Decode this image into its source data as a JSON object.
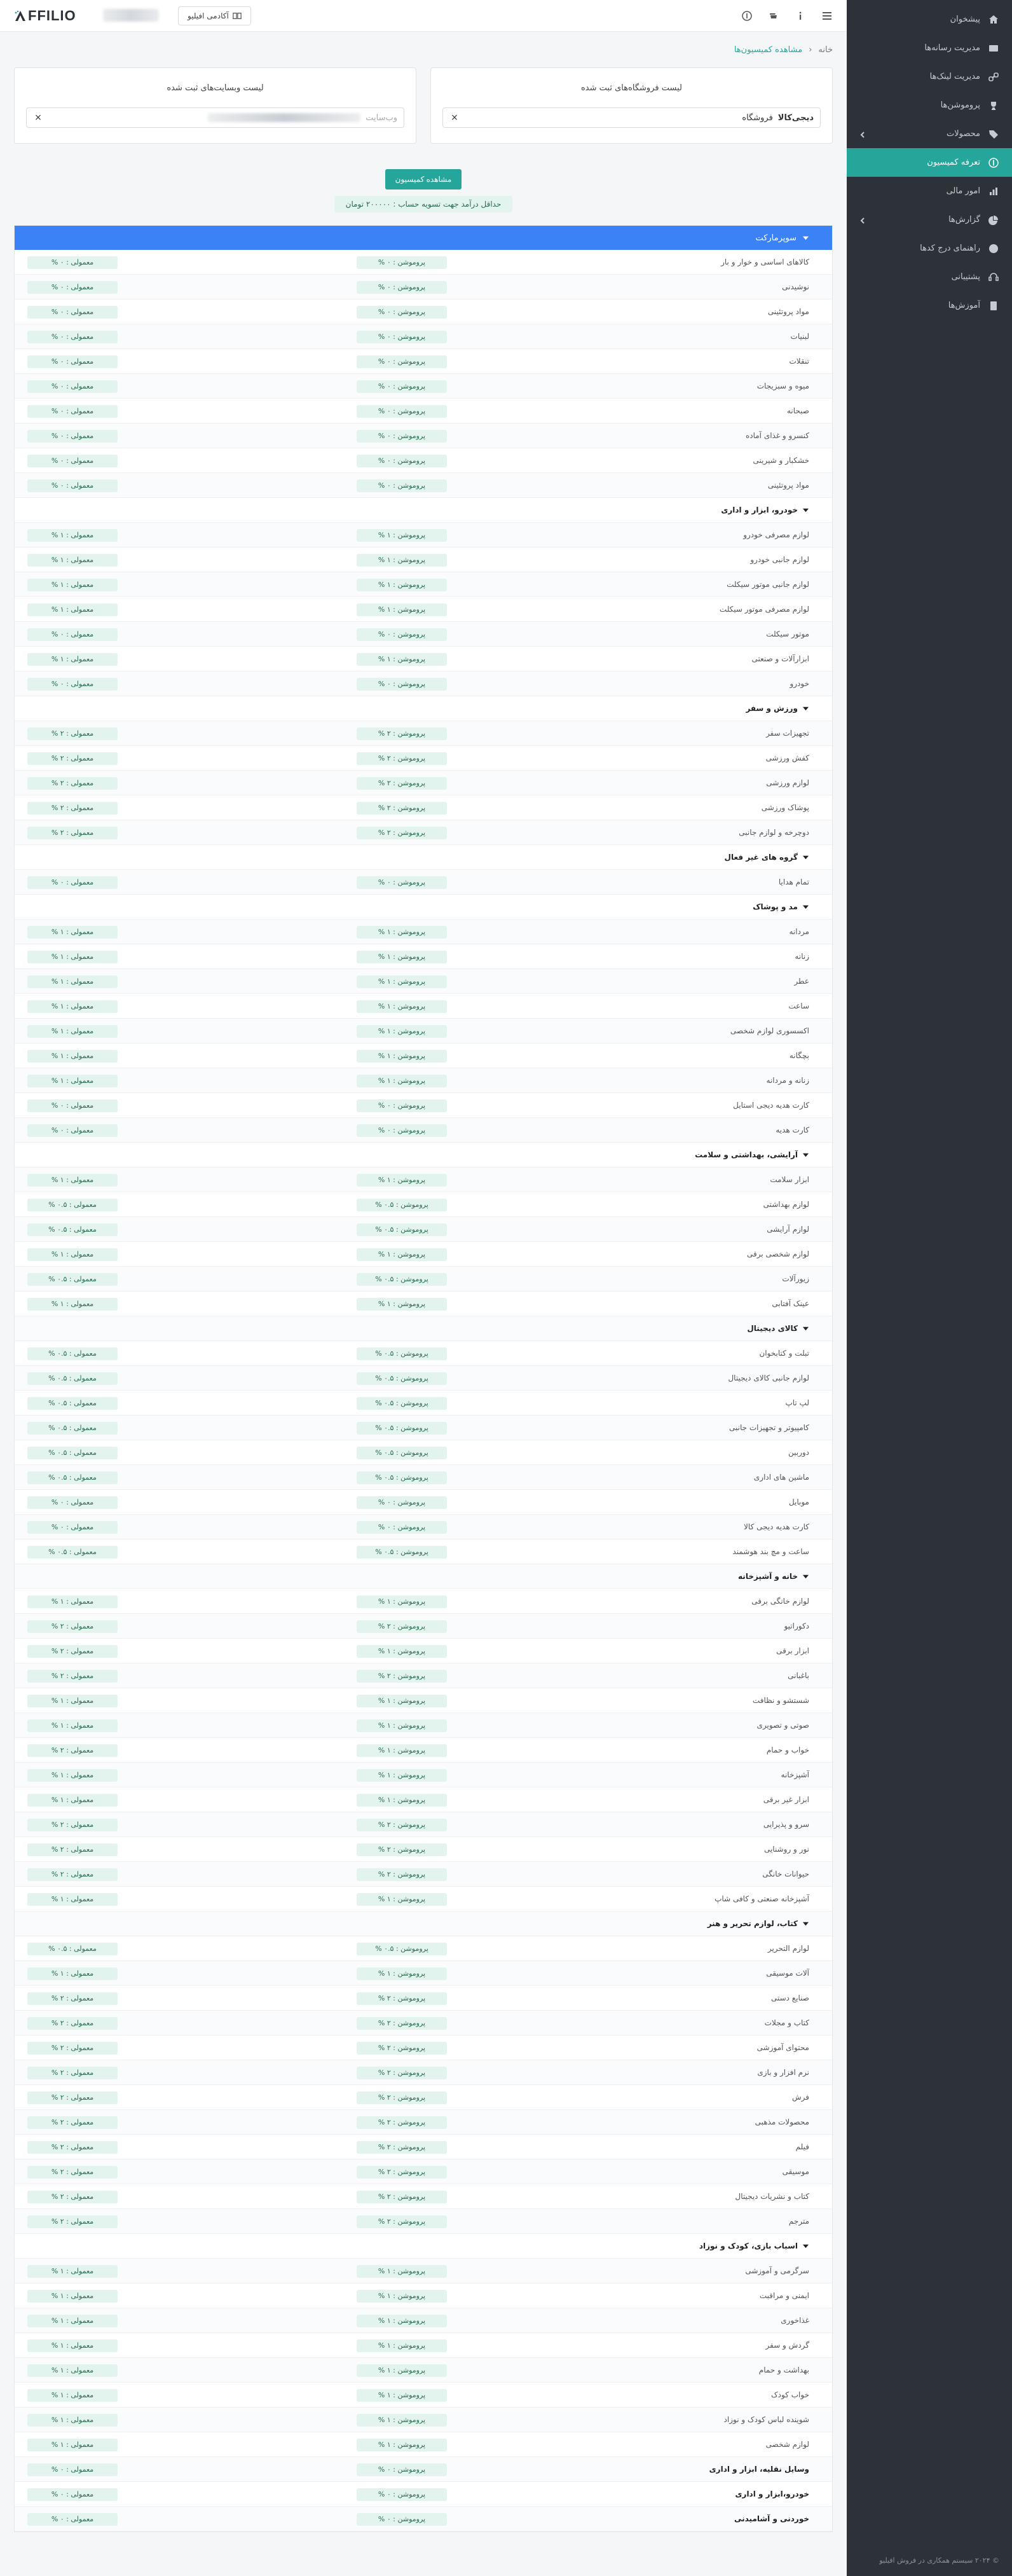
{
  "sidebar": {
    "items": [
      {
        "label": "پیشخوان",
        "icon": "home-icon",
        "active": false,
        "has_chevron": false
      },
      {
        "label": "مدیریت رسانه‌ها",
        "icon": "media-icon",
        "active": false,
        "has_chevron": false
      },
      {
        "label": "مدیریت لینک‌ها",
        "icon": "link-icon",
        "active": false,
        "has_chevron": false
      },
      {
        "label": "پروموشن‌ها",
        "icon": "trophy-icon",
        "active": false,
        "has_chevron": false
      },
      {
        "label": "محصولات",
        "icon": "tags-icon",
        "active": false,
        "has_chevron": true
      },
      {
        "label": "تعرفه کمیسیون",
        "icon": "dollar-icon",
        "active": true,
        "has_chevron": false
      },
      {
        "label": "امور مالی",
        "icon": "finance-icon",
        "active": false,
        "has_chevron": false
      },
      {
        "label": "گزارش‌ها",
        "icon": "pie-chart-icon",
        "active": false,
        "has_chevron": true
      },
      {
        "label": "راهنمای درج کدها",
        "icon": "help-icon",
        "active": false,
        "has_chevron": false
      },
      {
        "label": "پشتیبانی",
        "icon": "support-icon",
        "active": false,
        "has_chevron": false
      },
      {
        "label": "آموزش‌ها",
        "icon": "book-icon",
        "active": false,
        "has_chevron": false
      }
    ],
    "footer": "© ۲۰۲۴ سیستم همکاری در فروش افیلیو"
  },
  "topbar": {
    "academy_label": "آکادمی افیلیو",
    "logo_text": "FFILIO"
  },
  "breadcrumb": {
    "home": "خانه",
    "separator": "‹",
    "current": "مشاهده کمیسیون‌ها"
  },
  "filters": {
    "stores": {
      "title": "لیست فروشگاه‌های ثبت شده",
      "selected_name": "دیجی‌کالا",
      "selected_kind": "فروشگاه"
    },
    "websites": {
      "title": "لیست وبسایت‌های ثبت شده",
      "selected_kind": "وب‌سایت"
    }
  },
  "actions": {
    "view_button": "مشاهده کمیسیون",
    "min_settlement": "حداقل درآمد جهت تسویه حساب : ۲۰۰۰۰۰ تومان"
  },
  "table": {
    "header": "سوپرمارکت",
    "rows": [
      {
        "type": "item",
        "name": "کالاهای اساسی و خوار و بار",
        "promo": "پروموشن : ۰ %",
        "normal": "معمولی : ۰ %"
      },
      {
        "type": "item",
        "name": "نوشیدنی",
        "promo": "پروموشن : ۰ %",
        "normal": "معمولی : ۰ %"
      },
      {
        "type": "item",
        "name": "مواد پروتئینی",
        "promo": "پروموشن : ۰ %",
        "normal": "معمولی : ۰ %"
      },
      {
        "type": "item",
        "name": "لبنیات",
        "promo": "پروموشن : ۰ %",
        "normal": "معمولی : ۰ %"
      },
      {
        "type": "item",
        "name": "تنقلات",
        "promo": "پروموشن : ۰ %",
        "normal": "معمولی : ۰ %"
      },
      {
        "type": "item",
        "name": "میوه و سبزیجات",
        "promo": "پروموشن : ۰ %",
        "normal": "معمولی : ۰ %"
      },
      {
        "type": "item",
        "name": "صبحانه",
        "promo": "پروموشن : ۰ %",
        "normal": "معمولی : ۰ %"
      },
      {
        "type": "item",
        "name": "کنسرو و غذای آماده",
        "promo": "پروموشن : ۰ %",
        "normal": "معمولی : ۰ %"
      },
      {
        "type": "item",
        "name": "خشکبار و شیرینی",
        "promo": "پروموشن : ۰ %",
        "normal": "معمولی : ۰ %"
      },
      {
        "type": "item",
        "name": "مواد پروتئینی",
        "promo": "پروموشن : ۰ %",
        "normal": "معمولی : ۰ %"
      },
      {
        "type": "cat",
        "name": "خودرو، ابزار و اداری"
      },
      {
        "type": "item",
        "name": "لوازم مصرفی خودرو",
        "promo": "پروموشن : ۱ %",
        "normal": "معمولی : ۱ %"
      },
      {
        "type": "item",
        "name": "لوازم جانبی خودرو",
        "promo": "پروموشن : ۱ %",
        "normal": "معمولی : ۱ %"
      },
      {
        "type": "item",
        "name": "لوازم جانبی موتور سیکلت",
        "promo": "پروموشن : ۱ %",
        "normal": "معمولی : ۱ %"
      },
      {
        "type": "item",
        "name": "لوازم مصرفی موتور سیکلت",
        "promo": "پروموشن : ۱ %",
        "normal": "معمولی : ۱ %"
      },
      {
        "type": "item",
        "name": "موتور سیکلت",
        "promo": "پروموشن : ۰ %",
        "normal": "معمولی : ۰ %"
      },
      {
        "type": "item",
        "name": "ابزارآلات و صنعتی",
        "promo": "پروموشن : ۱ %",
        "normal": "معمولی : ۱ %"
      },
      {
        "type": "item",
        "name": "خودرو",
        "promo": "پروموشن : ۰ %",
        "normal": "معمولی : ۰ %"
      },
      {
        "type": "cat",
        "name": "ورزش و سفر"
      },
      {
        "type": "item",
        "name": "تجهیزات سفر",
        "promo": "پروموشن : ۲ %",
        "normal": "معمولی : ۲ %"
      },
      {
        "type": "item",
        "name": "کفش ورزشی",
        "promo": "پروموشن : ۲ %",
        "normal": "معمولی : ۲ %"
      },
      {
        "type": "item",
        "name": "لوازم ورزشی",
        "promo": "پروموشن : ۲ %",
        "normal": "معمولی : ۲ %"
      },
      {
        "type": "item",
        "name": "پوشاک ورزشی",
        "promo": "پروموشن : ۲ %",
        "normal": "معمولی : ۲ %"
      },
      {
        "type": "item",
        "name": "دوچرخه و لوازم جانبی",
        "promo": "پروموشن : ۲ %",
        "normal": "معمولی : ۲ %"
      },
      {
        "type": "cat",
        "name": "گروه های غیر فعال"
      },
      {
        "type": "item",
        "name": "تمام هدایا",
        "promo": "پروموشن : ۰ %",
        "normal": "معمولی : ۰ %"
      },
      {
        "type": "cat",
        "name": "مد و پوشاک"
      },
      {
        "type": "item",
        "name": "مردانه",
        "promo": "پروموشن : ۱ %",
        "normal": "معمولی : ۱ %"
      },
      {
        "type": "item",
        "name": "زنانه",
        "promo": "پروموشن : ۱ %",
        "normal": "معمولی : ۱ %"
      },
      {
        "type": "item",
        "name": "عطر",
        "promo": "پروموشن : ۱ %",
        "normal": "معمولی : ۱ %"
      },
      {
        "type": "item",
        "name": "ساعت",
        "promo": "پروموشن : ۱ %",
        "normal": "معمولی : ۱ %"
      },
      {
        "type": "item",
        "name": "اکسسوری لوازم شخصی",
        "promo": "پروموشن : ۱ %",
        "normal": "معمولی : ۱ %"
      },
      {
        "type": "item",
        "name": "بچگانه",
        "promo": "پروموشن : ۱ %",
        "normal": "معمولی : ۱ %"
      },
      {
        "type": "item",
        "name": "زنانه و مردانه",
        "promo": "پروموشن : ۱ %",
        "normal": "معمولی : ۱ %"
      },
      {
        "type": "item",
        "name": "کارت هدیه دیجی استایل",
        "promo": "پروموشن : ۰ %",
        "normal": "معمولی : ۰ %"
      },
      {
        "type": "item",
        "name": "کارت هدیه",
        "promo": "پروموشن : ۰ %",
        "normal": "معمولی : ۰ %"
      },
      {
        "type": "cat",
        "name": "آرایشی، بهداشتی و سلامت"
      },
      {
        "type": "item",
        "name": "ابزار سلامت",
        "promo": "پروموشن : ۱ %",
        "normal": "معمولی : ۱ %"
      },
      {
        "type": "item",
        "name": "لوازم بهداشتی",
        "promo": "پروموشن : ۰.۵ %",
        "normal": "معمولی : ۰.۵ %"
      },
      {
        "type": "item",
        "name": "لوازم آرایشی",
        "promo": "پروموشن : ۰.۵ %",
        "normal": "معمولی : ۰.۵ %"
      },
      {
        "type": "item",
        "name": "لوازم شخصی برقی",
        "promo": "پروموشن : ۱ %",
        "normal": "معمولی : ۱ %"
      },
      {
        "type": "item",
        "name": "زیورآلات",
        "promo": "پروموشن : ۰.۵ %",
        "normal": "معمولی : ۰.۵ %"
      },
      {
        "type": "item",
        "name": "عینک آفتابی",
        "promo": "پروموشن : ۱ %",
        "normal": "معمولی : ۱ %"
      },
      {
        "type": "cat",
        "name": "کالای دیجیتال"
      },
      {
        "type": "item",
        "name": "تبلت و کتابخوان",
        "promo": "پروموشن : ۰.۵ %",
        "normal": "معمولی : ۰.۵ %"
      },
      {
        "type": "item",
        "name": "لوازم جانبی کالای دیجیتال",
        "promo": "پروموشن : ۰.۵ %",
        "normal": "معمولی : ۰.۵ %"
      },
      {
        "type": "item",
        "name": "لپ تاپ",
        "promo": "پروموشن : ۰.۵ %",
        "normal": "معمولی : ۰.۵ %"
      },
      {
        "type": "item",
        "name": "کامپیوتر و تجهیزات جانبی",
        "promo": "پروموشن : ۰.۵ %",
        "normal": "معمولی : ۰.۵ %"
      },
      {
        "type": "item",
        "name": "دوربین",
        "promo": "پروموشن : ۰.۵ %",
        "normal": "معمولی : ۰.۵ %"
      },
      {
        "type": "item",
        "name": "ماشین های اداری",
        "promo": "پروموشن : ۰.۵ %",
        "normal": "معمولی : ۰.۵ %"
      },
      {
        "type": "item",
        "name": "موبایل",
        "promo": "پروموشن : ۰ %",
        "normal": "معمولی : ۰ %"
      },
      {
        "type": "item",
        "name": "کارت هدیه دیجی کالا",
        "promo": "پروموشن : ۰ %",
        "normal": "معمولی : ۰ %"
      },
      {
        "type": "item",
        "name": "ساعت و مچ بند هوشمند",
        "promo": "پروموشن : ۰.۵ %",
        "normal": "معمولی : ۰.۵ %"
      },
      {
        "type": "cat",
        "name": "خانه و آشپزخانه"
      },
      {
        "type": "item",
        "name": "لوازم خانگی برقی",
        "promo": "پروموشن : ۱ %",
        "normal": "معمولی : ۱ %"
      },
      {
        "type": "item",
        "name": "دکوراتیو",
        "promo": "پروموشن : ۲ %",
        "normal": "معمولی : ۲ %"
      },
      {
        "type": "item",
        "name": "ابزار برقی",
        "promo": "پروموشن : ۱ %",
        "normal": "معمولی : ۲ %"
      },
      {
        "type": "item",
        "name": "باغبانی",
        "promo": "پروموشن : ۲ %",
        "normal": "معمولی : ۲ %"
      },
      {
        "type": "item",
        "name": "شستشو و نظافت",
        "promo": "پروموشن : ۱ %",
        "normal": "معمولی : ۱ %"
      },
      {
        "type": "item",
        "name": "صوتی و تصویری",
        "promo": "پروموشن : ۱ %",
        "normal": "معمولی : ۱ %"
      },
      {
        "type": "item",
        "name": "خواب و حمام",
        "promo": "پروموشن : ۱ %",
        "normal": "معمولی : ۲ %"
      },
      {
        "type": "item",
        "name": "آشپزخانه",
        "promo": "پروموشن : ۱ %",
        "normal": "معمولی : ۱ %"
      },
      {
        "type": "item",
        "name": "ابزار غیر برقی",
        "promo": "پروموشن : ۱ %",
        "normal": "معمولی : ۱ %"
      },
      {
        "type": "item",
        "name": "سرو و پذیرایی",
        "promo": "پروموشن : ۲ %",
        "normal": "معمولی : ۲ %"
      },
      {
        "type": "item",
        "name": "نور و روشنایی",
        "promo": "پروموشن : ۲ %",
        "normal": "معمولی : ۲ %"
      },
      {
        "type": "item",
        "name": "حیوانات خانگی",
        "promo": "پروموشن : ۲ %",
        "normal": "معمولی : ۲ %"
      },
      {
        "type": "item",
        "name": "آشپزخانه صنعتی و کافی شاپ",
        "promo": "پروموشن : ۱ %",
        "normal": "معمولی : ۱ %"
      },
      {
        "type": "cat",
        "name": "کتاب، لوازم تحریر و هنر"
      },
      {
        "type": "item",
        "name": "لوازم التحریر",
        "promo": "پروموشن : ۰.۵ %",
        "normal": "معمولی : ۰.۵ %"
      },
      {
        "type": "item",
        "name": "آلات موسیقی",
        "promo": "پروموشن : ۱ %",
        "normal": "معمولی : ۱ %"
      },
      {
        "type": "item",
        "name": "صنایع دستی",
        "promo": "پروموشن : ۲ %",
        "normal": "معمولی : ۲ %"
      },
      {
        "type": "item",
        "name": "کتاب و مجلات",
        "promo": "پروموشن : ۲ %",
        "normal": "معمولی : ۲ %"
      },
      {
        "type": "item",
        "name": "محتوای آموزشی",
        "promo": "پروموشن : ۲ %",
        "normal": "معمولی : ۲ %"
      },
      {
        "type": "item",
        "name": "نرم افزار و بازی",
        "promo": "پروموشن : ۲ %",
        "normal": "معمولی : ۲ %"
      },
      {
        "type": "item",
        "name": "فرش",
        "promo": "پروموشن : ۲ %",
        "normal": "معمولی : ۲ %"
      },
      {
        "type": "item",
        "name": "محصولات مذهبی",
        "promo": "پروموشن : ۲ %",
        "normal": "معمولی : ۲ %"
      },
      {
        "type": "item",
        "name": "فیلم",
        "promo": "پروموشن : ۲ %",
        "normal": "معمولی : ۲ %"
      },
      {
        "type": "item",
        "name": "موسیقی",
        "promo": "پروموشن : ۲ %",
        "normal": "معمولی : ۲ %"
      },
      {
        "type": "item",
        "name": "کتاب و نشریات دیجیتال",
        "promo": "پروموشن : ۲ %",
        "normal": "معمولی : ۲ %"
      },
      {
        "type": "item",
        "name": "مترجم",
        "promo": "پروموشن : ۲ %",
        "normal": "معمولی : ۲ %"
      },
      {
        "type": "cat",
        "name": "اسباب بازی، کودک و نوزاد"
      },
      {
        "type": "item",
        "name": "سرگرمی و آموزشی",
        "promo": "پروموشن : ۱ %",
        "normal": "معمولی : ۱ %"
      },
      {
        "type": "item",
        "name": "ایمنی و مراقبت",
        "promo": "پروموشن : ۱ %",
        "normal": "معمولی : ۱ %"
      },
      {
        "type": "item",
        "name": "غذاخوری",
        "promo": "پروموشن : ۱ %",
        "normal": "معمولی : ۱ %"
      },
      {
        "type": "item",
        "name": "گردش و سفر",
        "promo": "پروموشن : ۱ %",
        "normal": "معمولی : ۱ %"
      },
      {
        "type": "item",
        "name": "بهداشت و حمام",
        "promo": "پروموشن : ۱ %",
        "normal": "معمولی : ۱ %"
      },
      {
        "type": "item",
        "name": "خواب کودک",
        "promo": "پروموشن : ۱ %",
        "normal": "معمولی : ۱ %"
      },
      {
        "type": "item",
        "name": "شوینده لباس کودک و نوزاد",
        "promo": "پروموشن : ۱ %",
        "normal": "معمولی : ۱ %"
      },
      {
        "type": "item",
        "name": "لوازم شخصی",
        "promo": "پروموشن : ۱ %",
        "normal": "معمولی : ۱ %"
      },
      {
        "type": "bold",
        "name": "وسایل نقلیه، ابزار و اداری",
        "promo": "پروموشن : ۰ %",
        "normal": "معمولی : ۰ %"
      },
      {
        "type": "bold",
        "name": "خودرو،ابزار و اداری",
        "promo": "پروموشن : ۰ %",
        "normal": "معمولی : ۰ %"
      },
      {
        "type": "bold",
        "name": "خوردنی و آشامیدنی",
        "promo": "پروموشن : ۰ %",
        "normal": "معمولی : ۰ %"
      }
    ]
  }
}
